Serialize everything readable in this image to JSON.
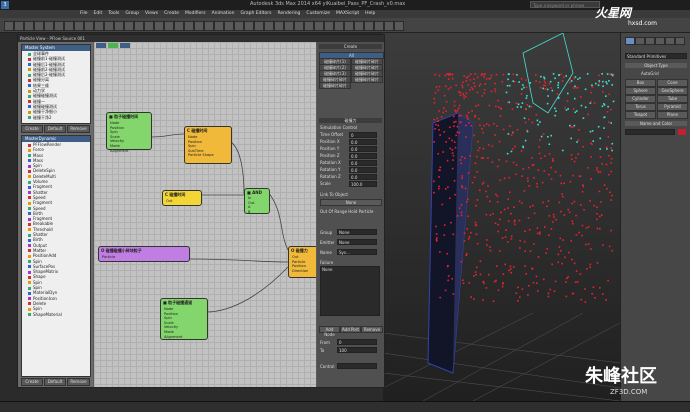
{
  "window": {
    "title": "Autodesk 3ds Max 2014 x64    yiKuaibei_Pass_PF_Crash_v0.max",
    "search_placeholder": "Type a keyword or phrase"
  },
  "menubar": [
    "File",
    "Edit",
    "Tools",
    "Group",
    "Views",
    "Create",
    "Modifiers",
    "Animation",
    "Graph Editors",
    "Rendering",
    "Customize",
    "MAXScript",
    "Help"
  ],
  "pflow": {
    "title": "Particle View - PFlow Source 001",
    "scene_panel": {
      "header": "Master System",
      "items": [
        "全球事件",
        "碰撞前1-碰撞测试",
        "碰撞后1-碰撞测试",
        "碰撞前2-碰撞测试",
        "碰撞后2-碰撞测试",
        "碰撞分离",
        "结果三维",
        "动力学",
        "碰撞碰撞测试",
        "碰撞一",
        "碰撞碰撞测试",
        "碰撞干净细小",
        "碰撞干净2",
        "碰撞一",
        "碰撞干净",
        "散射"
      ],
      "buttons": [
        "Create",
        "Default",
        "Remove"
      ]
    },
    "depot_panel": {
      "header": "MasterDynamic",
      "items": [
        "PFFlowRender",
        "Force",
        "Mass",
        "Mass",
        "Spin",
        "DeleteSpin",
        "DeleteMulti",
        "Volume",
        "Fragment",
        "Shatter",
        "Speed",
        "Fragment",
        "Speed",
        "Birth",
        "Fragment",
        "Breakable",
        "Threshold",
        "Shatter",
        "Birth",
        "Output",
        "Matter",
        "PositionAdd",
        "Spin",
        "SurfacePos",
        "ShapeMatrix",
        "Shape",
        "Spin",
        "Spin",
        "MaterialDyn",
        "PositionIcon",
        "Delete",
        "Spin",
        "ShapeMaterial"
      ],
      "buttons": [
        "Create",
        "Default",
        "Remove"
      ]
    },
    "nodes": [
      {
        "id": "n1",
        "color": "green",
        "title": "■ 粒子碰撞时间",
        "params": [
          "Node",
          "Position",
          "Spin",
          "Scale",
          "Velocity",
          "Mode",
          "Alignment"
        ]
      },
      {
        "id": "n2",
        "color": "orange",
        "title": "C 碰撞时间",
        "params": [
          "Node",
          "Position",
          "Spin",
          "SubTime",
          "Particle Shape"
        ]
      },
      {
        "id": "n3",
        "color": "yellow",
        "title": "C 碰撞时间",
        "params": [
          "Out"
        ]
      },
      {
        "id": "n4",
        "color": "green",
        "title": "■ AND",
        "params": [
          "In",
          "Out",
          "A",
          "B"
        ]
      },
      {
        "id": "n5",
        "color": "purple",
        "title": "O 碰撞碰撞小碎块粒子",
        "params": [
          "Particle"
        ]
      },
      {
        "id": "n6",
        "color": "orange",
        "title": "O 碰撞力",
        "params": [
          "Out",
          "Particle",
          "Position",
          "Direction"
        ]
      },
      {
        "id": "n7",
        "color": "green",
        "title": "■ 粒子碰撞通道",
        "params": [
          "Node",
          "Position",
          "Spin",
          "Scale",
          "Velocity",
          "Mode",
          "Alignment"
        ]
      }
    ],
    "props": {
      "header": "Create",
      "rows": [
        "All",
        "碰撞碎片(1)",
        "碰撞碎片碎片",
        "碰撞碎片(2)",
        "碰撞碎片碎片",
        "碰撞碎片(3)",
        "碰撞碎片碎片",
        "碰撞碎片碎片",
        "碰撞碎片碎片",
        "碰撞碎片碎片"
      ],
      "sim_section": "碰撞力",
      "sim_sub": "Simulation Control",
      "fields": [
        {
          "label": "Time Offset",
          "value": "0"
        },
        {
          "label": "Position X",
          "value": "0.0"
        },
        {
          "label": "Position Y",
          "value": "0.0"
        },
        {
          "label": "Position Z",
          "value": "0.0"
        },
        {
          "label": "Rotation X",
          "value": "0.0"
        },
        {
          "label": "Rotation Y",
          "value": "0.0"
        },
        {
          "label": "Rotation Z",
          "value": "0.0"
        },
        {
          "label": "Scale",
          "value": "100.0"
        }
      ],
      "link_label": "Link To Object",
      "link_value": "None",
      "output_label": "Out Of Range Hold Particle",
      "group_label": "Group",
      "group_value": "None",
      "emitter_label": "Emitter",
      "emitter_value": "None",
      "name_label": "Name",
      "name_value": "Sys...",
      "failure_label": "Failure",
      "failure_value": "None",
      "add_buttons": [
        "Add Node",
        "Add Port",
        "Remove"
      ],
      "from_label": "From",
      "to_label": "To",
      "from_value": "0",
      "to_value": "100",
      "control_label": "Control"
    }
  },
  "right_panel": {
    "dropdown": "Standard Primitives",
    "section": "Object Type",
    "autogrid": "AutoGrid",
    "objects": [
      "Box",
      "Cone",
      "Sphere",
      "GeoSphere",
      "Cylinder",
      "Tube",
      "Torus",
      "Pyramid",
      "Teapot",
      "Plane"
    ],
    "name_section": "Name and Color"
  },
  "watermark": {
    "top_cn": "火星网",
    "top_en": "hxsd.com",
    "bottom_cn": "朱峰社区",
    "bottom_en": "ZF3D.COM"
  },
  "colors": {
    "particle_red": "#e8232e",
    "particle_cyan": "#41e0d0",
    "column_blue": "#3344aa"
  }
}
